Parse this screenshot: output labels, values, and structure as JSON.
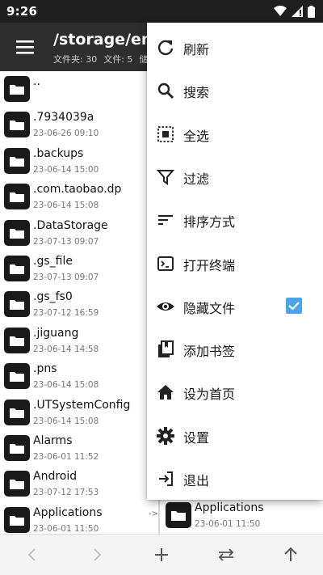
{
  "status_bar": {
    "time": "9:26"
  },
  "app_bar": {
    "path": "/storage/emu",
    "folders_label": "文件夹: 30",
    "files_label": "文件: 5",
    "extra_label": "储"
  },
  "left_pane": {
    "items": [
      {
        "name": "..",
        "date": ""
      },
      {
        "name": ".7934039a",
        "date": "23-06-26 09:10"
      },
      {
        "name": ".backups",
        "date": "23-06-14 15:00"
      },
      {
        "name": ".com.taobao.dp",
        "date": "23-06-14 15:08"
      },
      {
        "name": ".DataStorage",
        "date": "23-07-13 09:07"
      },
      {
        "name": ".gs_file",
        "date": "23-07-13 09:07"
      },
      {
        "name": ".gs_fs0",
        "date": "23-07-12 16:59"
      },
      {
        "name": ".jiguang",
        "date": "23-06-14 14:58"
      },
      {
        "name": ".pns",
        "date": "23-06-14 15:08"
      },
      {
        "name": ".UTSystemConfig",
        "date": "23-06-14 15:08"
      },
      {
        "name": "Alarms",
        "date": "23-06-01 11:52"
      },
      {
        "name": "Android",
        "date": "23-07-12 17:53"
      },
      {
        "name": "Applications",
        "date": "23-06-01 11:50"
      }
    ],
    "arrow": "->"
  },
  "right_pane": {
    "visible_item": {
      "name": "Applications",
      "date": "23-06-01 11:50"
    }
  },
  "menu": {
    "items": [
      {
        "label": "刷新",
        "icon": "refresh-icon"
      },
      {
        "label": "搜索",
        "icon": "search-icon"
      },
      {
        "label": "全选",
        "icon": "select-all-icon"
      },
      {
        "label": "过滤",
        "icon": "filter-icon"
      },
      {
        "label": "排序方式",
        "icon": "sort-icon"
      },
      {
        "label": "打开终端",
        "icon": "terminal-icon"
      },
      {
        "label": "隐藏文件",
        "icon": "eye-icon",
        "checked": true
      },
      {
        "label": "添加书签",
        "icon": "bookmark-icon"
      },
      {
        "label": "设为首页",
        "icon": "home-icon"
      },
      {
        "label": "设置",
        "icon": "gear-icon"
      },
      {
        "label": "退出",
        "icon": "exit-icon"
      }
    ]
  },
  "bottom_bar": {
    "buttons": [
      "back-icon",
      "forward-icon",
      "add-icon",
      "swap-icon",
      "up-icon"
    ]
  },
  "colors": {
    "status_bar": "#1f1f1f",
    "app_bar": "#2e2e2e",
    "folder": "#1a1a1a",
    "checkbox": "#4ba3e8"
  }
}
